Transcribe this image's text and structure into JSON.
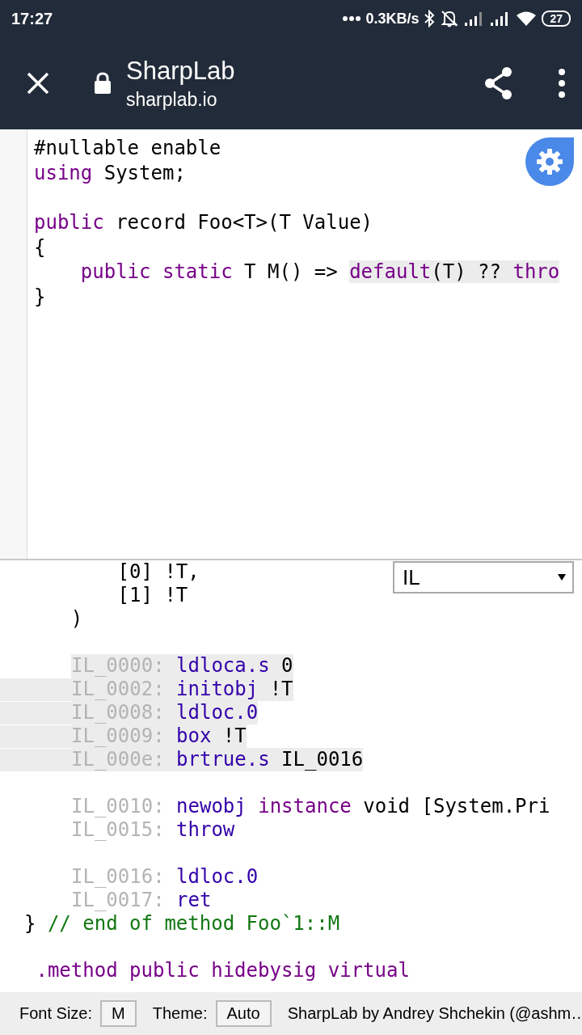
{
  "status_bar": {
    "time": "17:27",
    "net_speed": "0.3KB/s",
    "battery": "27"
  },
  "toolbar": {
    "title": "SharpLab",
    "url": "sharplab.io"
  },
  "editor": {
    "lines": [
      {
        "kind": "code",
        "tokens": [
          {
            "t": "#nullable enable",
            "kind": "plain",
            "highlighted": false
          }
        ]
      },
      {
        "kind": "code",
        "tokens": [
          {
            "t": "using",
            "kind": "keyword",
            "highlighted": false
          },
          {
            "t": " System;",
            "kind": "plain",
            "highlighted": false
          }
        ]
      },
      {
        "kind": "blank"
      },
      {
        "kind": "code",
        "tokens": [
          {
            "t": "public",
            "kind": "keyword",
            "highlighted": false
          },
          {
            "t": " record Foo<T>(T Value)",
            "kind": "plain",
            "highlighted": false
          }
        ]
      },
      {
        "kind": "code",
        "tokens": [
          {
            "t": "{",
            "kind": "plain",
            "highlighted": false
          }
        ]
      },
      {
        "kind": "code",
        "tokens": [
          {
            "t": "    public",
            "kind": "keyword",
            "highlighted": false
          },
          {
            "t": " static",
            "kind": "keyword",
            "highlighted": false
          },
          {
            "t": " T M() => ",
            "kind": "plain",
            "highlighted": false
          },
          {
            "t": "default",
            "kind": "keyword",
            "highlighted": true
          },
          {
            "t": "(T) ?? ",
            "kind": "plain",
            "highlighted": true
          },
          {
            "t": "thro",
            "kind": "keyword",
            "highlighted": true
          }
        ]
      },
      {
        "kind": "code",
        "tokens": [
          {
            "t": "}",
            "kind": "plain",
            "highlighted": false
          }
        ]
      }
    ]
  },
  "output": {
    "language": "IL",
    "lines": [
      {
        "kind": "code",
        "tokens": [
          {
            "t": "        [0] !T,",
            "kind": "plain",
            "highlighted": false
          }
        ]
      },
      {
        "kind": "code",
        "tokens": [
          {
            "t": "        [1] !T",
            "kind": "plain",
            "highlighted": false
          }
        ]
      },
      {
        "kind": "code",
        "tokens": [
          {
            "t": "    )",
            "kind": "plain",
            "highlighted": false
          }
        ]
      },
      {
        "kind": "blank"
      },
      {
        "kind": "il",
        "label": "IL_0000:",
        "opcode": "ldloca.s",
        "operand": "0",
        "highlighted": true,
        "row_highlighted": false
      },
      {
        "kind": "il",
        "label": "IL_0002:",
        "opcode": "initobj",
        "operand": "!T",
        "highlighted": true,
        "row_highlighted": true
      },
      {
        "kind": "il",
        "label": "IL_0008:",
        "opcode": "ldloc.0",
        "highlighted": true,
        "row_highlighted": true
      },
      {
        "kind": "il",
        "label": "IL_0009:",
        "opcode": "box",
        "operand": "!T",
        "highlighted": true,
        "row_highlighted": true
      },
      {
        "kind": "il",
        "label": "IL_000e:",
        "opcode": "brtrue.s",
        "operand": "IL_0016",
        "highlighted": true,
        "row_highlighted": true
      },
      {
        "kind": "blank"
      },
      {
        "kind": "il",
        "label": "IL_0010:",
        "opcode": "newobj",
        "tokens": [
          {
            "t": "instance",
            "kind": "keyword",
            "highlighted": false
          },
          {
            "t": " void [System.Pri",
            "kind": "plain",
            "highlighted": false
          }
        ],
        "highlighted": false,
        "row_highlighted": false
      },
      {
        "kind": "il",
        "label": "IL_0015:",
        "opcode": "throw",
        "highlighted": false,
        "row_highlighted": false
      },
      {
        "kind": "blank"
      },
      {
        "kind": "il",
        "label": "IL_0016:",
        "opcode": "ldloc.0",
        "highlighted": false,
        "row_highlighted": false
      },
      {
        "kind": "il",
        "label": "IL_0017:",
        "opcode": "ret",
        "highlighted": false,
        "row_highlighted": false
      },
      {
        "kind": "code",
        "tokens": [
          {
            "t": "}",
            "kind": "plain",
            "highlighted": false
          },
          {
            "t": " // end of method Foo`1::M",
            "kind": "comment",
            "highlighted": false
          }
        ]
      },
      {
        "kind": "blank"
      },
      {
        "kind": "code",
        "tokens": [
          {
            "t": " .method public hidebysig virtual",
            "kind": "keyword",
            "highlighted": false
          }
        ]
      }
    ]
  },
  "footer": {
    "font_size_label": "Font Size:",
    "font_size": "M",
    "theme_label": "Theme:",
    "theme": "Auto",
    "credit": "SharpLab by Andrey Shchekin (@ashm…"
  }
}
